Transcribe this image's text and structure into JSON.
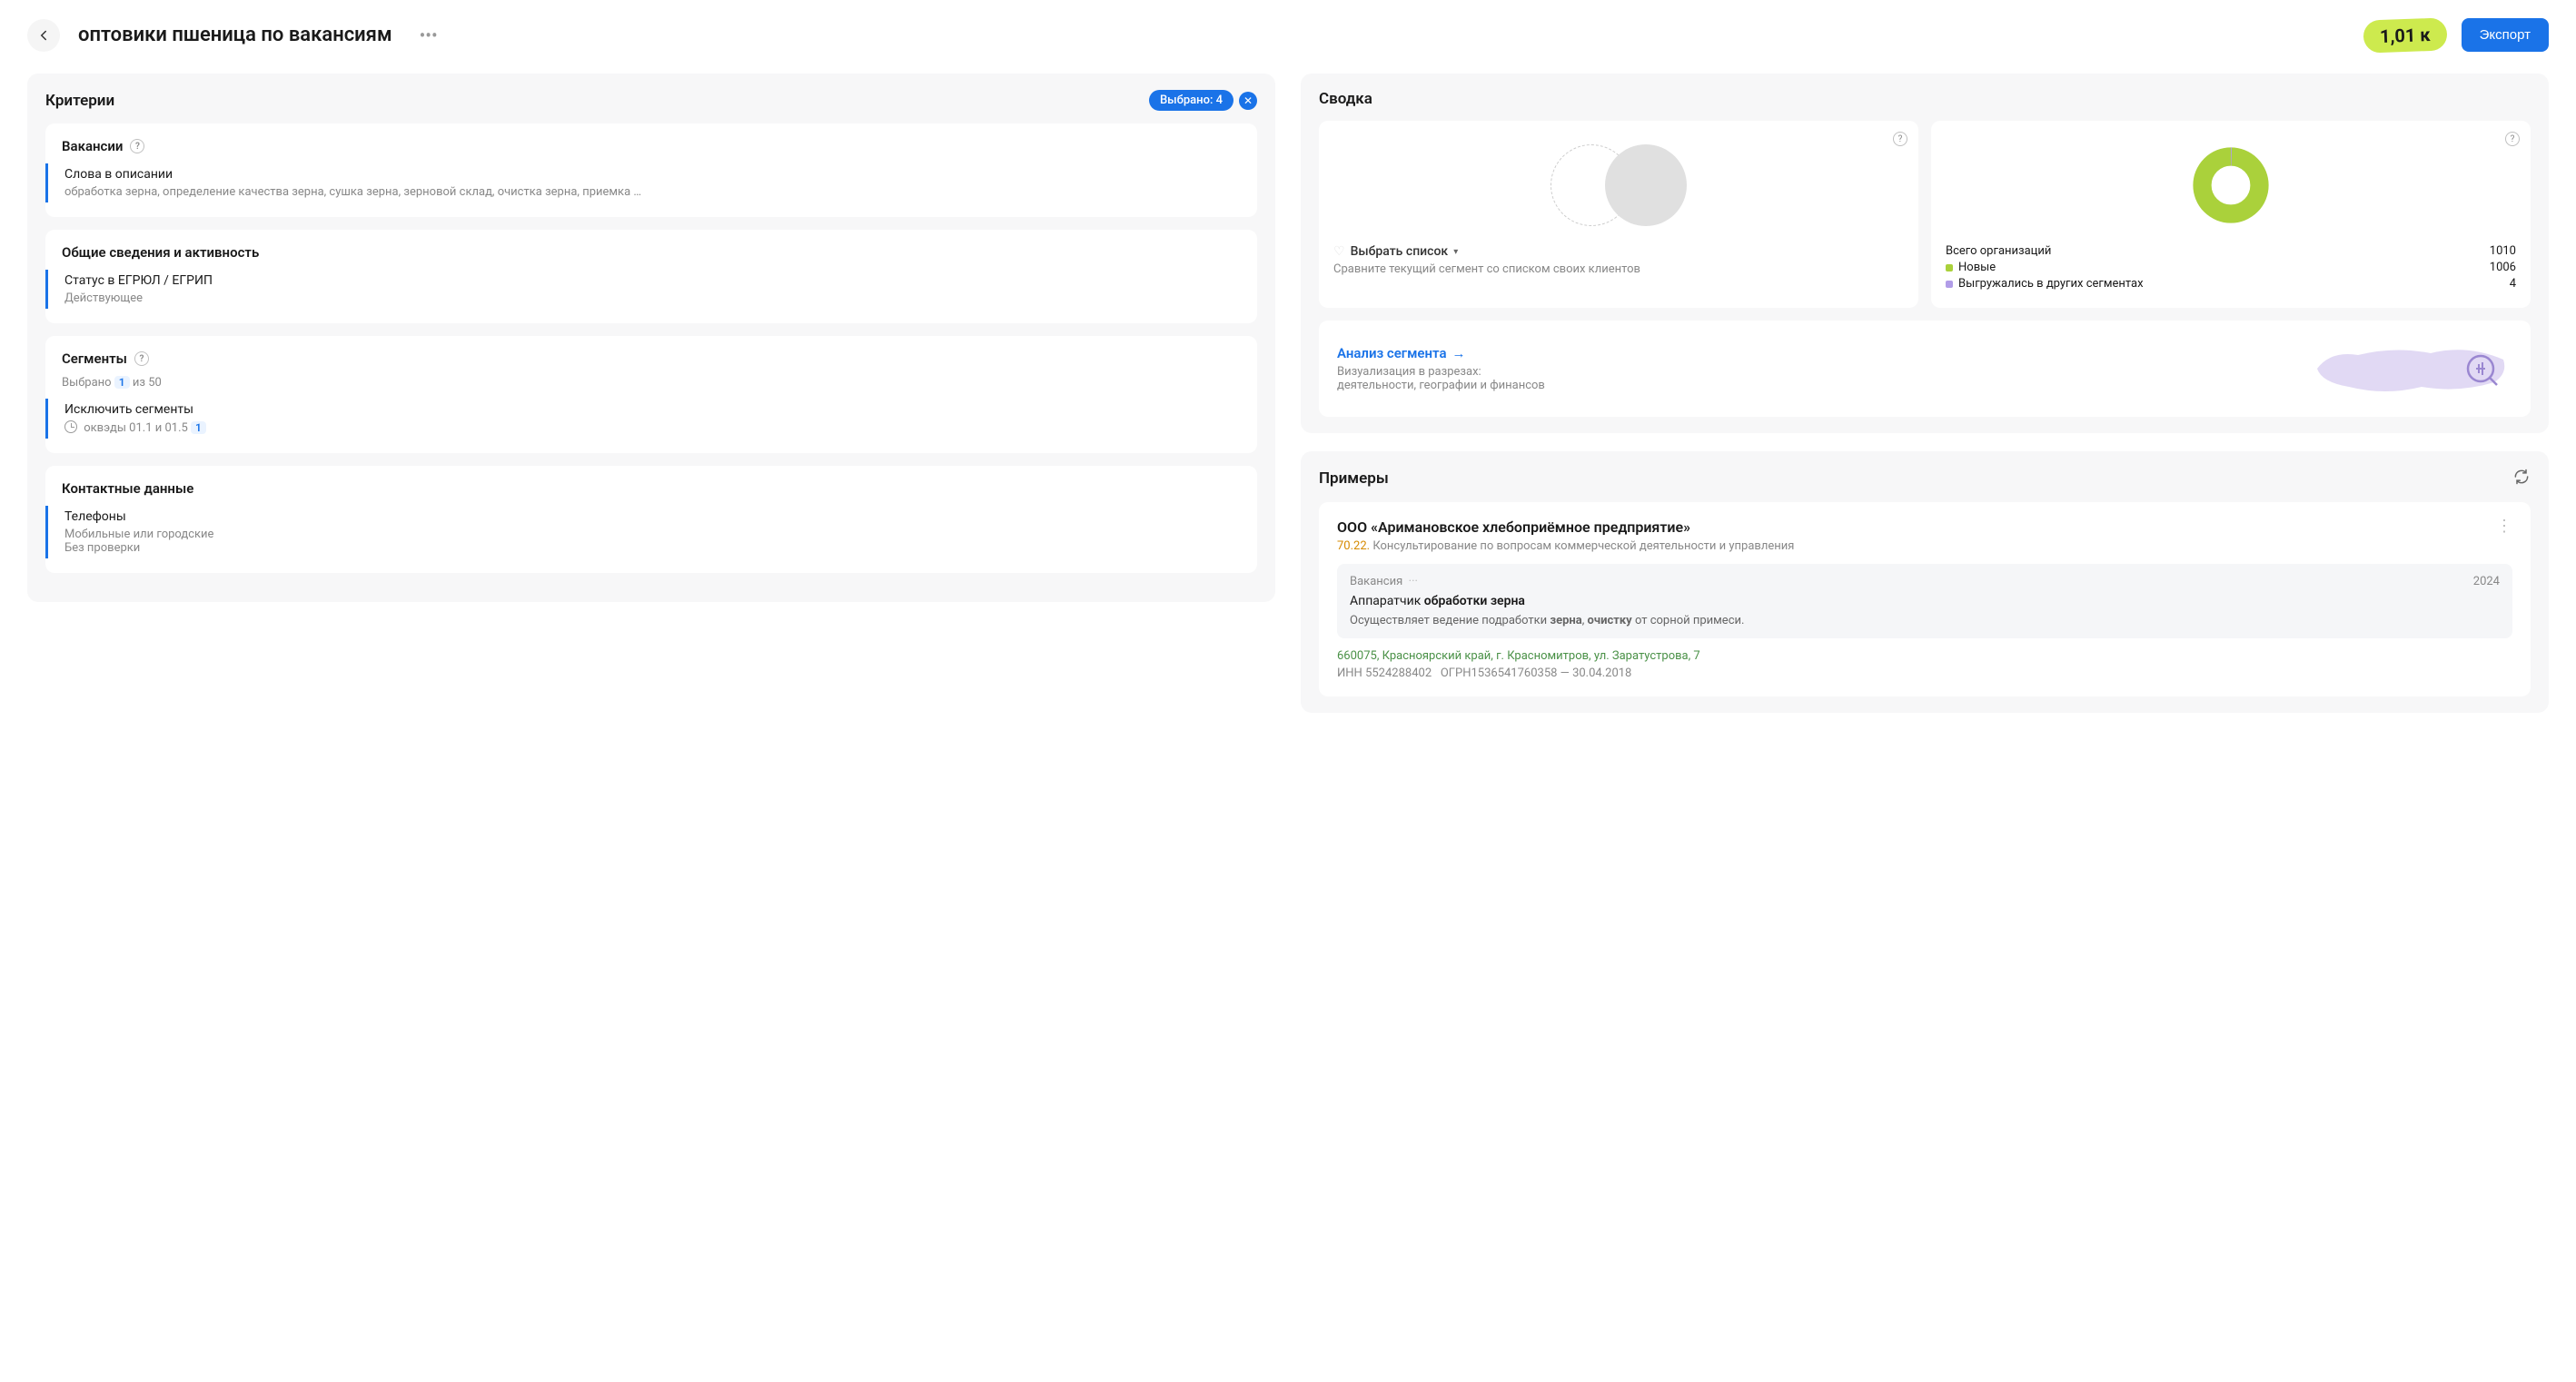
{
  "header": {
    "title": "оптовики пшеница по  вакансиям",
    "count": "1,01 к",
    "export_label": "Экспорт"
  },
  "criteria": {
    "title": "Критерии",
    "selected_label": "Выбрано: 4",
    "sections": {
      "vacancies": {
        "title": "Вакансии",
        "item_label": "Слова в описании",
        "item_value": "обработка зерна, определение качества зерна, сушка зерна, зерновой склад, очистка зерна, приемка …"
      },
      "general": {
        "title": "Общие сведения и активность",
        "item_label": "Статус в ЕГРЮЛ / ЕГРИП",
        "item_value": "Действующее"
      },
      "segments": {
        "title": "Сегменты",
        "subtitle_prefix": "Выбрано",
        "subtitle_count": "1",
        "subtitle_suffix": "из 50",
        "item_label": "Исключить сегменты",
        "item_value": "оквэды 01.1 и 01.5",
        "item_badge": "1"
      },
      "contacts": {
        "title": "Контактные данные",
        "item_label": "Телефоны",
        "item_value1": "Мобильные или городские",
        "item_value2": "Без проверки"
      }
    }
  },
  "summary": {
    "title": "Сводка",
    "compare": {
      "select_label": "Выбрать список",
      "hint": "Сравните текущий сегмент со списком своих клиентов"
    },
    "orgs": {
      "total_label": "Всего организаций",
      "total_value": "1010",
      "new_label": "Новые",
      "new_value": "1006",
      "exported_label": "Выгружались в других сегментах",
      "exported_value": "4"
    },
    "analysis": {
      "link": "Анализ сегмента",
      "sub1": "Визуализация в разрезах:",
      "sub2": "деятельности, географии и финансов"
    }
  },
  "examples": {
    "title": "Примеры",
    "company": {
      "name": "ООО «Аримановское хлебоприёмное предприятие»",
      "code": "70.22.",
      "activity": "Консультирование по вопросам коммерческой деятельности и управления",
      "vacancy_label": "Вакансия",
      "vacancy_year": "2024",
      "vacancy_title_pre": "Аппаратчик ",
      "vacancy_title_bold": "обработки зерна",
      "vacancy_desc_pre": "Осуществляет ведение подработки ",
      "vacancy_desc_b1": "зерна",
      "vacancy_desc_mid": ", ",
      "vacancy_desc_b2": "очистку",
      "vacancy_desc_post": " от сорной примеси.",
      "address": "660075, Красноярский край,  г. Красномитров, ул. Заратустрова, 7",
      "inn_label": "ИНН",
      "inn": "5524288402",
      "ogrn_label": "ОГРН",
      "ogrn": "1536541760358",
      "ogrn_date": "30.04.2018"
    }
  },
  "chart_data": {
    "type": "pie",
    "title": "Всего организаций",
    "total": 1010,
    "series": [
      {
        "name": "Новые",
        "value": 1006,
        "color": "#aad13b"
      },
      {
        "name": "Выгружались в других сегментах",
        "value": 4,
        "color": "#b19de8"
      }
    ]
  }
}
